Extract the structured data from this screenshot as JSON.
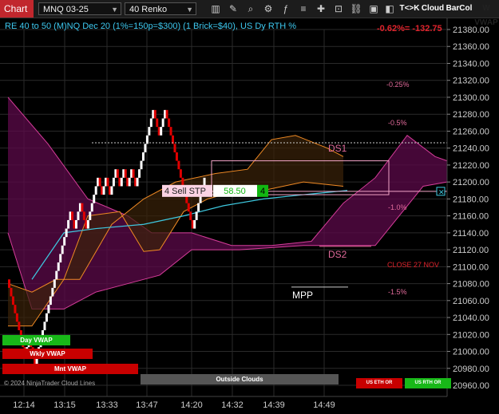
{
  "toolbar": {
    "chart_tab": "Chart",
    "instrument": "MNQ 03-25",
    "bar_type": "40 Renko",
    "buttons": [
      {
        "label": "T<>K",
        "color": "#e87722"
      },
      {
        "label": "Cloud",
        "color": "#e0232c"
      },
      {
        "label": "BarCol",
        "color": "#e87722"
      },
      {
        "label": "W VWAP",
        "color": "#bbbbbb"
      }
    ]
  },
  "info_line": "RE 40 to 50 (M)NQ Dec 20 (1%=150p=$300) (1 Brick=$40), US Dy RTH %",
  "pnl_text": "-0.62%= -132.75",
  "order": {
    "label": "4 Sell STP",
    "pnl": "58.50",
    "qty": "4"
  },
  "price_flags": {
    "last": "21246.25",
    "stop": "21189.00"
  },
  "pct_labels": [
    "-0.25%",
    "-0.5%",
    "-1.0%",
    "-1.5%"
  ],
  "annotations": {
    "ds1": "DS1",
    "ds2": "DS2",
    "close": "CLOSE 27 NOV",
    "mpp": "MPP"
  },
  "bottom_labels": {
    "day_vwap": "Day VWAP",
    "wkly_vwap": "Wkly VWAP",
    "mnt_vwap": "Mnt VWAP",
    "copyright": "© 2024 NinjaTrader Cloud Lines",
    "outside_clouds": "Outside Clouds",
    "us_eth": "US ETH OR",
    "us_rth": "US RTH OR"
  },
  "colors": {
    "up_brick": "#ffffff",
    "down_brick": "#e00000",
    "cloud": "#5c0a4a",
    "cloud_edge": "#d63d9a",
    "orange": "#f08a24",
    "cyan": "#3ec9e0",
    "accent_green": "#12b812"
  },
  "chart_data": {
    "type": "line",
    "subtype": "renko",
    "brick_size": 10,
    "y_axis": {
      "min": 20960,
      "max": 21380,
      "ticks": [
        21380,
        21360,
        21340,
        21320,
        21300,
        21280,
        21260,
        21240,
        21220,
        21200,
        21180,
        21160,
        21140,
        21120,
        21100,
        21080,
        21060,
        21040,
        21020,
        21000,
        20980,
        20960
      ]
    },
    "x_ticks": [
      "12:14",
      "13:15",
      "13:33",
      "13:47",
      "14:20",
      "14:32",
      "14:39",
      "14:49"
    ],
    "bricks": [
      {
        "dir": "down",
        "count": 9
      },
      {
        "dir": "up",
        "count": 2
      },
      {
        "dir": "down",
        "count": 3
      },
      {
        "dir": "up",
        "count": 18
      },
      {
        "dir": "down",
        "count": 2
      },
      {
        "dir": "up",
        "count": 3
      },
      {
        "dir": "down",
        "count": 3
      },
      {
        "dir": "up",
        "count": 6
      },
      {
        "dir": "down",
        "count": 2
      },
      {
        "dir": "up",
        "count": 2
      },
      {
        "dir": "down",
        "count": 2
      },
      {
        "dir": "up",
        "count": 3
      },
      {
        "dir": "down",
        "count": 2
      },
      {
        "dir": "up",
        "count": 2
      },
      {
        "dir": "down",
        "count": 2
      },
      {
        "dir": "up",
        "count": 2
      },
      {
        "dir": "down",
        "count": 2
      },
      {
        "dir": "up",
        "count": 9
      },
      {
        "dir": "down",
        "count": 3
      },
      {
        "dir": "up",
        "count": 3
      },
      {
        "dir": "down",
        "count": 14
      },
      {
        "dir": "up",
        "count": 6
      }
    ],
    "last_price": 21246.25,
    "stop_price": 21189.0,
    "ds1_level": 21240,
    "ds2_level": 21124,
    "pct_levels": [
      21315,
      21270,
      21170,
      21070
    ]
  }
}
